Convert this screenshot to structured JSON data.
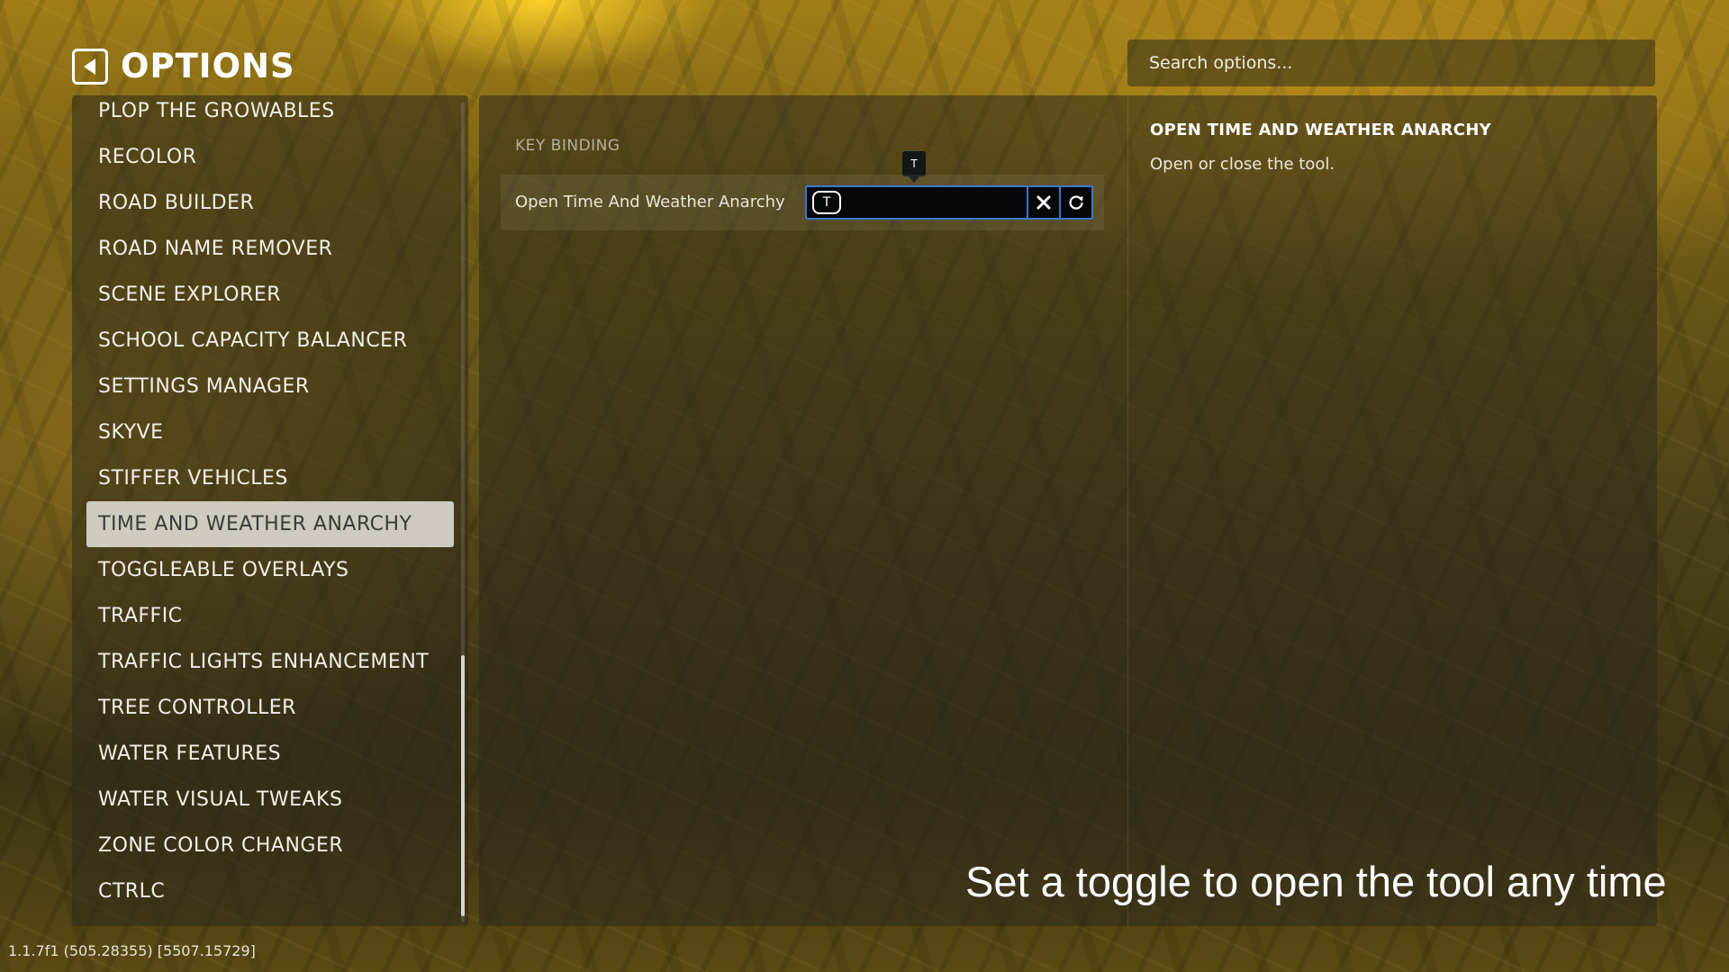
{
  "header": {
    "title": "OPTIONS",
    "back_icon": "back-arrow-icon"
  },
  "search": {
    "placeholder": "Search options..."
  },
  "sidebar": {
    "items": [
      {
        "label": "PLOP THE GROWABLES",
        "active": false
      },
      {
        "label": "RECOLOR",
        "active": false
      },
      {
        "label": "ROAD BUILDER",
        "active": false
      },
      {
        "label": "ROAD NAME REMOVER",
        "active": false
      },
      {
        "label": "SCENE EXPLORER",
        "active": false
      },
      {
        "label": "SCHOOL CAPACITY BALANCER",
        "active": false
      },
      {
        "label": "SETTINGS MANAGER",
        "active": false
      },
      {
        "label": "SKYVE",
        "active": false
      },
      {
        "label": "STIFFER VEHICLES",
        "active": false
      },
      {
        "label": "TIME AND WEATHER ANARCHY",
        "active": true
      },
      {
        "label": "TOGGLEABLE OVERLAYS",
        "active": false
      },
      {
        "label": "TRAFFIC",
        "active": false
      },
      {
        "label": "TRAFFIC LIGHTS ENHANCEMENT",
        "active": false
      },
      {
        "label": "TREE CONTROLLER",
        "active": false
      },
      {
        "label": "WATER FEATURES",
        "active": false
      },
      {
        "label": "WATER VISUAL TWEAKS",
        "active": false
      },
      {
        "label": "ZONE COLOR CHANGER",
        "active": false
      },
      {
        "label": "CTRLC",
        "active": false
      }
    ]
  },
  "main": {
    "section_label": "KEY BINDING",
    "binding": {
      "label": "Open Time And Weather Anarchy",
      "key": "T",
      "tooltip": "T",
      "clear_icon": "close-icon",
      "reset_icon": "reset-icon"
    },
    "description": {
      "title": "OPEN TIME AND WEATHER ANARCHY",
      "text": "Open or close the tool."
    }
  },
  "caption": "Set a toggle to open the tool any time",
  "version": "1.1.7f1 (505.28355) [5507.15729]",
  "colors": {
    "accent_border": "#3d76c8",
    "active_item_bg": "#e1ded6",
    "panel_bg": "rgba(45,42,28,0.55)"
  }
}
